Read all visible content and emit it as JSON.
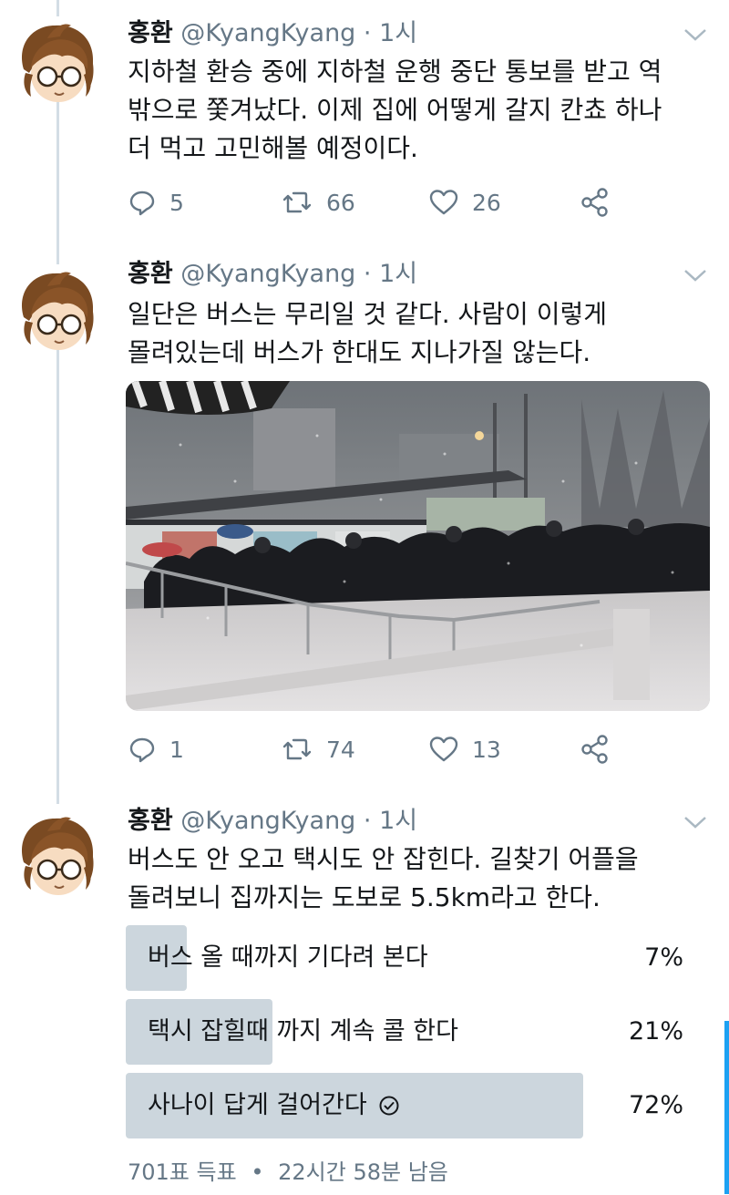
{
  "tweets": [
    {
      "name": "홍환",
      "handle": "@KyangKyang",
      "dot": "·",
      "time": "1시",
      "lines": [
        "지하철 환승 중에 지하철 운행 중단 통보를 받고 역",
        "밖으로 쫓겨났다. 이제 집에 어떻게 갈지 칸쵸 하나",
        "더 먹고 고민해볼 예정이다."
      ],
      "replies": "5",
      "retweets": "66",
      "likes": "26"
    },
    {
      "name": "홍환",
      "handle": "@KyangKyang",
      "dot": "·",
      "time": "1시",
      "lines": [
        "일단은 버스는 무리일 것 같다. 사람이 이렇게",
        "몰려있는데 버스가 한대도 지나가질 않는다."
      ],
      "replies": "1",
      "retweets": "74",
      "likes": "13"
    },
    {
      "name": "홍환",
      "handle": "@KyangKyang",
      "dot": "·",
      "time": "1시",
      "lines": [
        "버스도 안 오고 택시도 안 잡힌다. 길찾기 어플을",
        "돌려보니 집까지는 도보로 5.5km라고 한다."
      ],
      "poll": {
        "options": [
          {
            "label": "버스 올 때까지 기다려 본다",
            "percent": "7%",
            "share": 0.07
          },
          {
            "label": "택시 잡힐때 까지 계속 콜 한다",
            "percent": "21%",
            "share": 0.21
          },
          {
            "label": "사나이 답게 걸어간다",
            "percent": "72%",
            "share": 0.72,
            "selected": true
          }
        ],
        "votes": "701표 득표",
        "separator": "•",
        "remaining": "22시간 58분 남음"
      }
    }
  ],
  "icons": {
    "reply": "reply-icon",
    "retweet": "retweet-icon",
    "like": "heart-icon",
    "share": "share-icon",
    "menu": "chevron-down-icon",
    "check": "check-circle-icon"
  },
  "colors": {
    "text": "#14171a",
    "muted": "#657786",
    "thread": "#d3dde5",
    "pollBar": "#ccd6dd",
    "accent": "#1da1f2"
  }
}
